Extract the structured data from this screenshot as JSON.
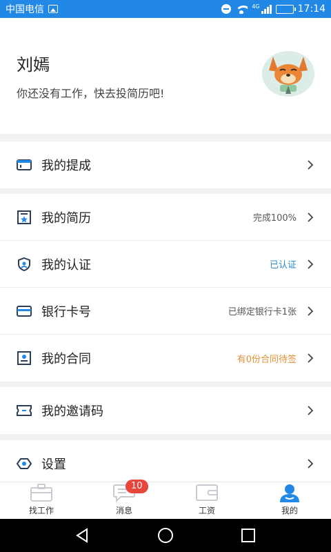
{
  "status_bar": {
    "carrier": "中国电信",
    "network": "4G",
    "time": "17:14",
    "battery_level": 0.9
  },
  "profile": {
    "name": "刘嫣",
    "hint": "你还没有工作，快去投简历吧!",
    "avatar_icon": "fox-avatar"
  },
  "menu": {
    "commission": {
      "label": "我的提成",
      "icon": "wallet-card-icon"
    },
    "resume": {
      "label": "我的简历",
      "value": "完成100%",
      "icon": "resume-star-icon"
    },
    "certification": {
      "label": "我的认证",
      "value": "已认证",
      "icon": "shield-user-icon",
      "value_color": "#2a8bd6"
    },
    "bank_card": {
      "label": "银行卡号",
      "value": "已绑定银行卡1张",
      "icon": "credit-card-icon"
    },
    "contract": {
      "label": "我的合同",
      "value": "有0份合同待签",
      "icon": "contract-person-icon",
      "value_color": "#e0913a"
    },
    "invite_code": {
      "label": "我的邀请码",
      "icon": "ticket-icon"
    },
    "settings": {
      "label": "设置",
      "icon": "eye-hexagon-icon"
    }
  },
  "tab_bar": {
    "tabs": [
      {
        "label": "找工作",
        "icon": "briefcase-icon",
        "active": false
      },
      {
        "label": "消息",
        "icon": "chat-bubble-icon",
        "active": false,
        "badge": "10"
      },
      {
        "label": "工资",
        "icon": "wallet-icon",
        "active": false
      },
      {
        "label": "我的",
        "icon": "person-icon",
        "active": true
      }
    ]
  },
  "colors": {
    "accent": "#2288e6",
    "badge": "#e8453c",
    "icon_dark": "#2c3e57"
  }
}
